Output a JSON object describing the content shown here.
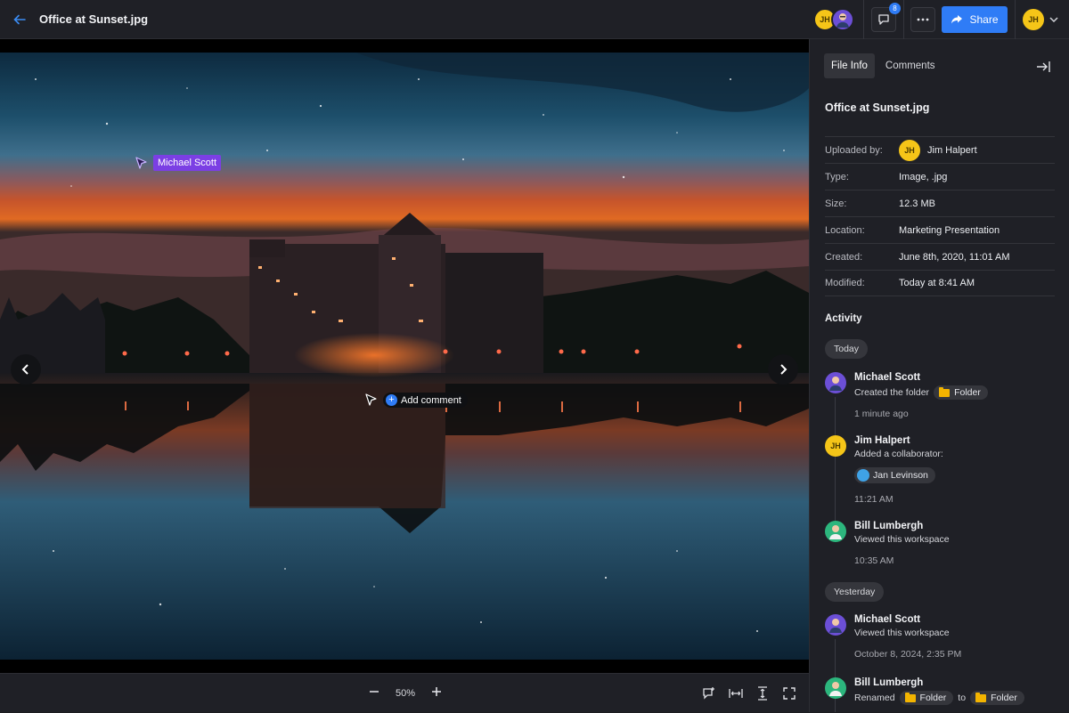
{
  "header": {
    "title": "Office at Sunset.jpg",
    "collaborators": [
      {
        "initials": "JH"
      },
      {
        "initials": ""
      }
    ],
    "comments_badge": "8",
    "share_label": "Share",
    "user_initials": "JH"
  },
  "viewer": {
    "cursor_user": "Michael Scott",
    "add_comment_label": "Add comment",
    "zoom": "50%"
  },
  "panel": {
    "tabs": [
      "File Info",
      "Comments"
    ],
    "active_tab": "File Info",
    "file_name": "Office at Sunset.jpg",
    "info": [
      {
        "key": "Uploaded by:",
        "value": "Jim Halpert",
        "avatar": "JH"
      },
      {
        "key": "Type:",
        "value": "Image, .jpg"
      },
      {
        "key": "Size:",
        "value": "12.3 MB"
      },
      {
        "key": "Location:",
        "value": "Marketing Presentation"
      },
      {
        "key": "Created:",
        "value": "June 8th, 2020, 11:01 AM"
      },
      {
        "key": "Modified:",
        "value": "Today at 8:41 AM"
      }
    ],
    "activity_title": "Activity",
    "groups": [
      {
        "label": "Today",
        "items": [
          {
            "name": "Michael Scott",
            "desc": "Created the folder",
            "chip": "Folder",
            "time": "1 minute ago"
          },
          {
            "name": "Jim Halpert",
            "avatar": "JH",
            "desc": "Added a collaborator:",
            "person": "Jan Levinson",
            "time": "11:21 AM"
          },
          {
            "name": "Bill Lumbergh",
            "desc": "Viewed this workspace",
            "time": "10:35 AM"
          }
        ]
      },
      {
        "label": "Yesterday",
        "items": [
          {
            "name": "Michael Scott",
            "desc": "Viewed this workspace",
            "time": "October 8, 2024, 2:35 PM"
          },
          {
            "name": "Bill Lumbergh",
            "desc": "Renamed",
            "chip": "Folder",
            "joiner": "to",
            "chip2": "Folder"
          }
        ]
      }
    ]
  },
  "colors": {
    "accent": "#2f7cf6",
    "cursor": "#7b3fe4",
    "folder": "#f3b400",
    "avatar_yellow": "#f5c518"
  }
}
